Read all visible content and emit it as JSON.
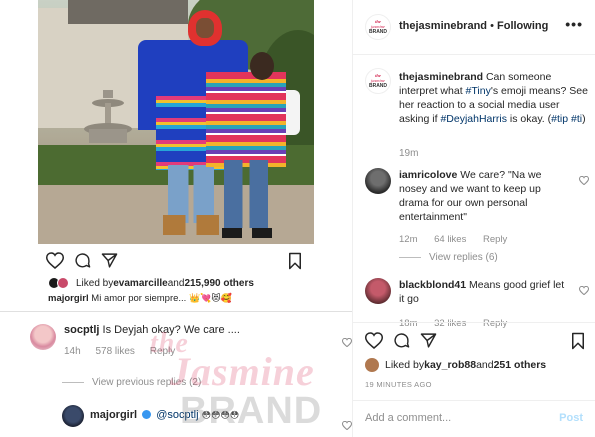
{
  "post_image": {
    "alt": "couple-in-serape-ponchos-photo"
  },
  "left_panel": {
    "liked_by_prefix": "Liked by ",
    "liked_by_user": "evamarcille",
    "liked_by_and": " and ",
    "liked_by_count": "215,990 others",
    "caption_user": "majorgirl",
    "caption_text": "Mi amor por siempre...",
    "caption_emojis": "👑💘😻🥰",
    "comment": {
      "user": "socptlj",
      "text": "Is Deyjah okay? We care ....",
      "time": "14h",
      "likes": "578 likes",
      "reply": "Reply"
    },
    "view_replies": "View previous replies (2)",
    "reply": {
      "user": "majorgirl",
      "mention": "@socptlj",
      "emojis": "😳😳😳😳"
    }
  },
  "watermark": {
    "the": "the",
    "jasmine": "Jasmine",
    "brand": "BRAND"
  },
  "header": {
    "logo_the": "the",
    "logo_jasmine": "jasmine",
    "logo_brand": "BRAND",
    "username": "thejasminebrand",
    "separator": " • ",
    "follow_status": "Following",
    "more": "•••"
  },
  "caption": {
    "user": "thejasminebrand",
    "text_1": " Can someone interpret what ",
    "tag_tiny": "#Tiny",
    "text_2": "'s emoji means? See her reaction to a social media user asking if ",
    "tag_deyjah": "#DeyjahHarris",
    "text_3": " is okay. (",
    "tag_tip": "#tip",
    "tag_ti": "#ti",
    "text_4": ")",
    "time": "19m"
  },
  "comments": [
    {
      "user": "iamricolove",
      "text": " We care? \"Na we nosey and we want to keep up drama for our own personal entertainment\"",
      "time": "12m",
      "likes": "64 likes",
      "reply": "Reply",
      "view_replies": "View replies (6)"
    },
    {
      "user": "blackblond41",
      "text": " Means good grief let it go",
      "time": "18m",
      "likes": "32 likes",
      "reply": "Reply"
    }
  ],
  "right_footer": {
    "liked_by_prefix": "Liked by ",
    "liked_by_user": "kay_rob88",
    "liked_by_and": " and ",
    "liked_by_count": "251 others",
    "time_ago": "19 MINUTES AGO",
    "add_comment_placeholder": "Add a comment...",
    "post_label": "Post"
  },
  "colors": {
    "link": "#003569",
    "muted": "#8e8e8e",
    "post_disabled": "#b2dffc",
    "brand_pink": "#d2234e"
  }
}
